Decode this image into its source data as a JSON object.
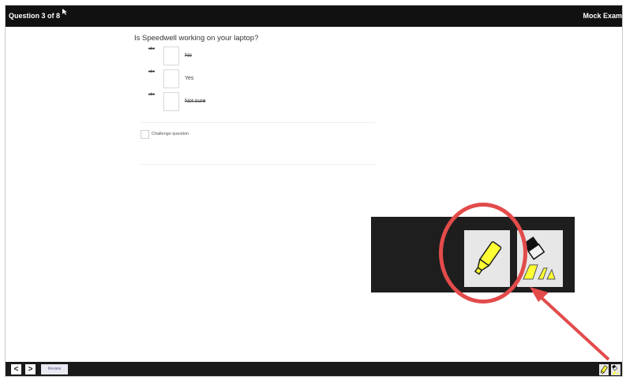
{
  "header": {
    "question_counter": "Question 3 of 8",
    "exam_title": "Mock Exam"
  },
  "question": {
    "text": "Is Speedwell working on your laptop?",
    "options": [
      {
        "label": "No",
        "struck": true
      },
      {
        "label": "Yes",
        "struck": false
      },
      {
        "label": "Not sure",
        "struck": true
      }
    ],
    "strike_icon": "abc"
  },
  "challenge": {
    "label": "Challenge question",
    "checked": false
  },
  "tools": {
    "highlighter_icon": "highlighter-icon",
    "eraser_icon": "highlighter-eraser-icon",
    "highlight_color": "#ffff33",
    "annotation_color": "#e34b4b"
  },
  "footer": {
    "prev_label": "<",
    "next_label": ">",
    "review_label": "Review"
  }
}
